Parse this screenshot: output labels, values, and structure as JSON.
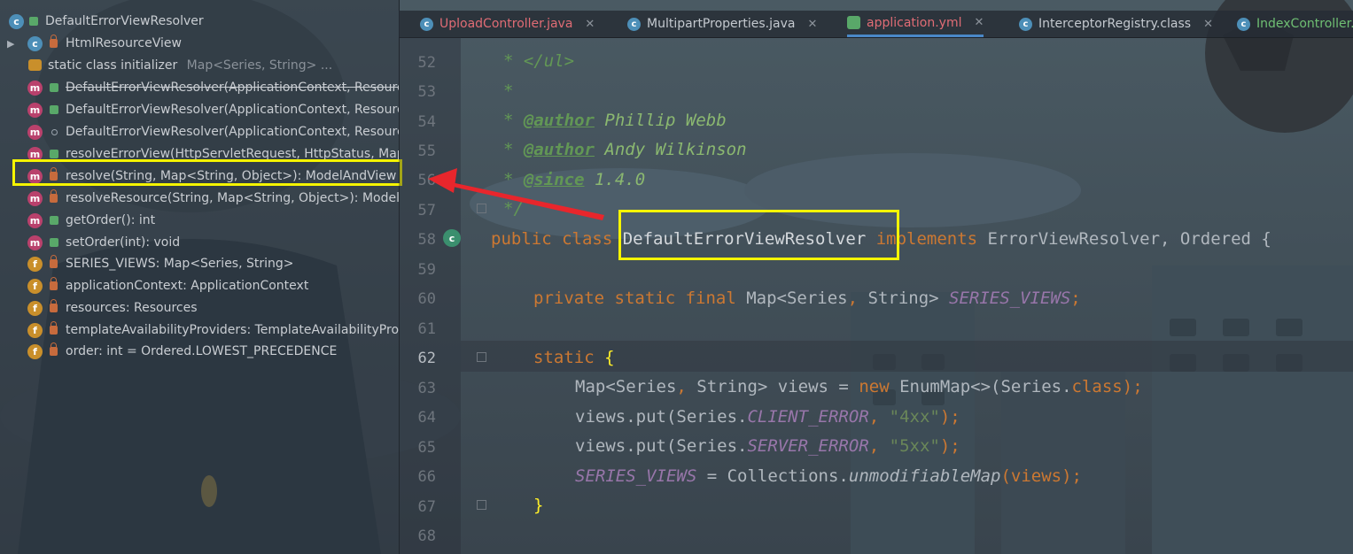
{
  "structure": {
    "header": "DefaultErrorViewResolver",
    "items": [
      {
        "label": "HtmlResourceView",
        "hint": "",
        "icon": "class-icon",
        "visibility": "private"
      },
      {
        "label": "static class initializer",
        "hint": "Map<Series, String> ...",
        "icon": "initializer-icon",
        "visibility": ""
      },
      {
        "label": "DefaultErrorViewResolver(ApplicationContext, Resource",
        "hint": "",
        "icon": "method-icon",
        "visibility": "public"
      },
      {
        "label": "DefaultErrorViewResolver(ApplicationContext, Resource",
        "hint": "",
        "icon": "method-icon",
        "visibility": "public"
      },
      {
        "label": "DefaultErrorViewResolver(ApplicationContext, Resource",
        "hint": "",
        "icon": "method-icon",
        "visibility": "package"
      },
      {
        "label": "resolveErrorView(HttpServletRequest, HttpStatus, Map<",
        "hint": "",
        "icon": "method-icon",
        "visibility": "public"
      },
      {
        "label": "resolve(String, Map<String, Object>): ModelAndView",
        "hint": "",
        "icon": "method-icon",
        "visibility": "private"
      },
      {
        "label": "resolveResource(String, Map<String, Object>): ModelAn",
        "hint": "",
        "icon": "method-icon",
        "visibility": "private"
      },
      {
        "label": "getOrder(): int",
        "hint": "",
        "icon": "method-icon",
        "visibility": "public"
      },
      {
        "label": "setOrder(int): void",
        "hint": "",
        "icon": "method-icon",
        "visibility": "public"
      },
      {
        "label": "SERIES_VIEWS: Map<Series, String>",
        "hint": "",
        "icon": "field-icon",
        "visibility": "private"
      },
      {
        "label": "applicationContext: ApplicationContext",
        "hint": "",
        "icon": "field-icon",
        "visibility": "private"
      },
      {
        "label": "resources: Resources",
        "hint": "",
        "icon": "field-icon",
        "visibility": "private"
      },
      {
        "label": "templateAvailabilityProviders: TemplateAvailabilityProvi",
        "hint": "",
        "icon": "field-icon",
        "visibility": "private"
      },
      {
        "label": "order: int = Ordered.LOWEST_PRECEDENCE",
        "hint": "",
        "icon": "field-icon",
        "visibility": "private"
      }
    ]
  },
  "tabs": [
    {
      "label": "UploadController.java",
      "color": "#e06c75"
    },
    {
      "label": "MultipartProperties.java",
      "color": "#c4c9cf"
    },
    {
      "label": "application.yml",
      "color": "#e06c75"
    },
    {
      "label": "InterceptorRegistry.class",
      "color": "#c4c9cf"
    },
    {
      "label": "IndexController.",
      "color": "#6fbf73"
    }
  ],
  "editor": {
    "line_numbers": [
      "52",
      "53",
      "54",
      "55",
      "56",
      "57",
      "58",
      "59",
      "60",
      "61",
      "62",
      "63",
      "64",
      "65",
      "66",
      "67",
      "68"
    ],
    "current_line": "62",
    "tokens": {
      "l52": "* </ul>",
      "l53": "*",
      "l54_star": "* ",
      "l54_tag": "@author",
      "l54_val": " Phillip Webb",
      "l55_star": "* ",
      "l55_tag": "@author",
      "l55_val": " Andy Wilkinson",
      "l56_star": "* ",
      "l56_tag": "@since",
      "l56_val": " 1.4.0",
      "l57": "*/",
      "l58_kw": "public class ",
      "l58_cls": "DefaultErrorViewResolver",
      "l58_kw2": " implements ",
      "l58_rest": "ErrorViewResolver, Ordered {",
      "l60_kw": "private static final ",
      "l60_type": "Map<Series",
      "l60_comma": ", ",
      "l60_type2": "String> ",
      "l60_field": "SERIES_VIEWS",
      "l60_semi": ";",
      "l62_kw": "static ",
      "l62_brace": "{",
      "l63_a": "Map<Series",
      "l63_comma": ", ",
      "l63_b": "String> views = ",
      "l63_new": "new ",
      "l63_c": "EnumMap<>(Series.",
      "l63_class": "class",
      "l63_end": ");",
      "l64_a": "views.put(Series.",
      "l64_field": "CLIENT_ERROR",
      "l64_comma": ", ",
      "l64_str": "\"4xx\"",
      "l64_end": ");",
      "l65_a": "views.put(Series.",
      "l65_field": "SERVER_ERROR",
      "l65_comma": ", ",
      "l65_str": "\"5xx\"",
      "l65_end": ");",
      "l66_field": "SERIES_VIEWS",
      "l66_a": " = Collections.",
      "l66_method": "unmodifiableMap",
      "l66_end": "(views);",
      "l67_brace": "}"
    }
  },
  "annotation_colors": {
    "highlight_box": "#f5f400",
    "arrow": "#e8262c"
  }
}
